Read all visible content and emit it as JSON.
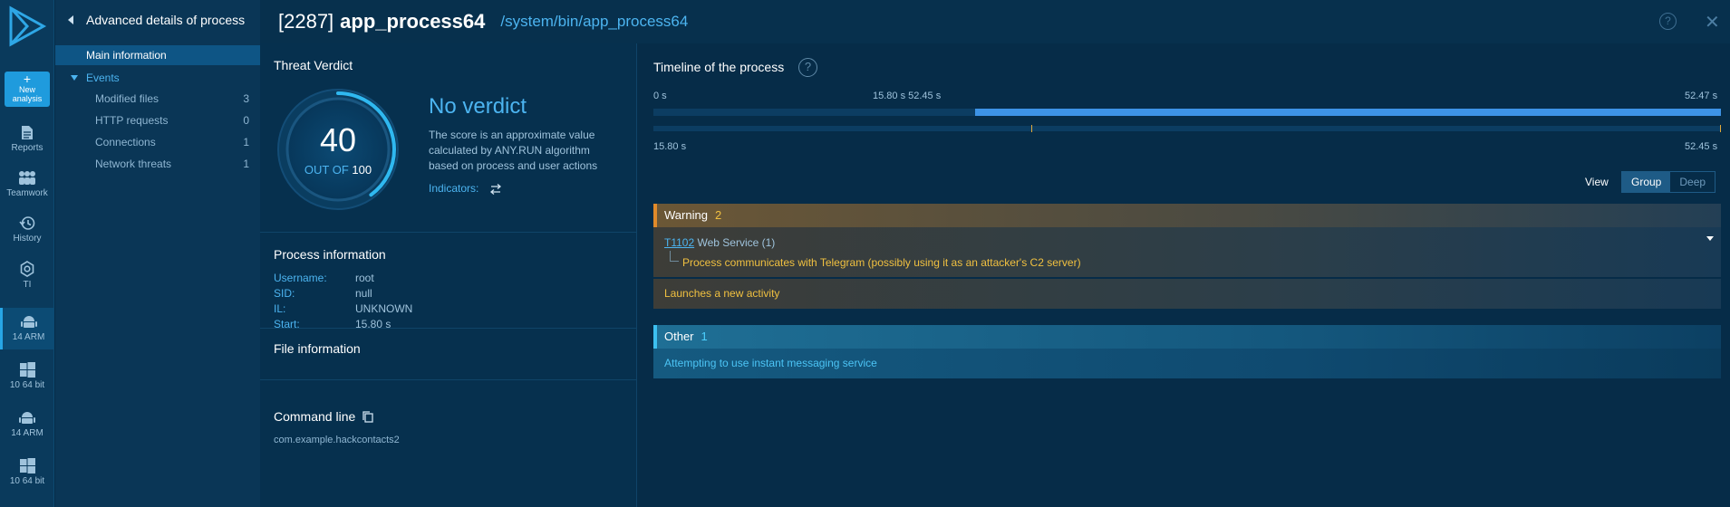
{
  "rail": {
    "new_analysis": "New analysis",
    "items": [
      {
        "label": "Reports",
        "icon": "document-icon"
      },
      {
        "label": "Teamwork",
        "icon": "team-icon"
      },
      {
        "label": "History",
        "icon": "history-icon"
      },
      {
        "label": "TI",
        "icon": "gear-icon"
      }
    ],
    "tasks": [
      {
        "label": "14 ARM",
        "icon": "android-icon",
        "active": true
      },
      {
        "label": "10 64 bit",
        "icon": "windows-icon"
      },
      {
        "label": "14 ARM",
        "icon": "android-icon"
      },
      {
        "label": "10 64 bit",
        "icon": "windows-icon"
      }
    ]
  },
  "nav": {
    "title": "Advanced details of process",
    "main": "Main information",
    "events": "Events",
    "sub": [
      {
        "label": "Modified files",
        "count": "3"
      },
      {
        "label": "HTTP requests",
        "count": "0"
      },
      {
        "label": "Connections",
        "count": "1"
      },
      {
        "label": "Network threats",
        "count": "1"
      }
    ]
  },
  "header": {
    "pid": "[2287]",
    "name": "app_process64",
    "path": "/system/bin/app_process64",
    "help": "?",
    "close": "✕"
  },
  "verdict": {
    "title": "Threat Verdict",
    "score": "40",
    "out_of": "OUT OF",
    "max": "100",
    "score_fraction": 0.4,
    "label": "No verdict",
    "description": "The score is an approximate value calculated by ANY.RUN algorithm based on process and user actions",
    "indicators": "Indicators:"
  },
  "process_info": {
    "title": "Process information",
    "rows": [
      {
        "key": "Username:",
        "value": "root"
      },
      {
        "key": "SID:",
        "value": "null"
      },
      {
        "key": "IL:",
        "value": "UNKNOWN"
      },
      {
        "key": "Start:",
        "value": "15.80 s"
      }
    ]
  },
  "file_info": {
    "title": "File information"
  },
  "command_line": {
    "title": "Command line",
    "value": "com.example.hackcontacts2"
  },
  "timeline": {
    "title": "Timeline of the process",
    "help": "?",
    "start": "0 s",
    "mid": "15.80 s 52.45 s",
    "end": "52.47 s",
    "sub_start": "15.80 s",
    "sub_end": "52.45 s"
  },
  "view": {
    "label": "View",
    "group": "Group",
    "deep": "Deep"
  },
  "warning": {
    "title": "Warning",
    "count": "2",
    "tech_id": "T1102",
    "tech_name": "Web Service (1)",
    "tech_detail": "Process communicates with Telegram (possibly using it as an attacker's C2 server)",
    "second": "Launches a new activity"
  },
  "other": {
    "title": "Other",
    "count": "1",
    "item": "Attempting to use instant messaging service"
  }
}
